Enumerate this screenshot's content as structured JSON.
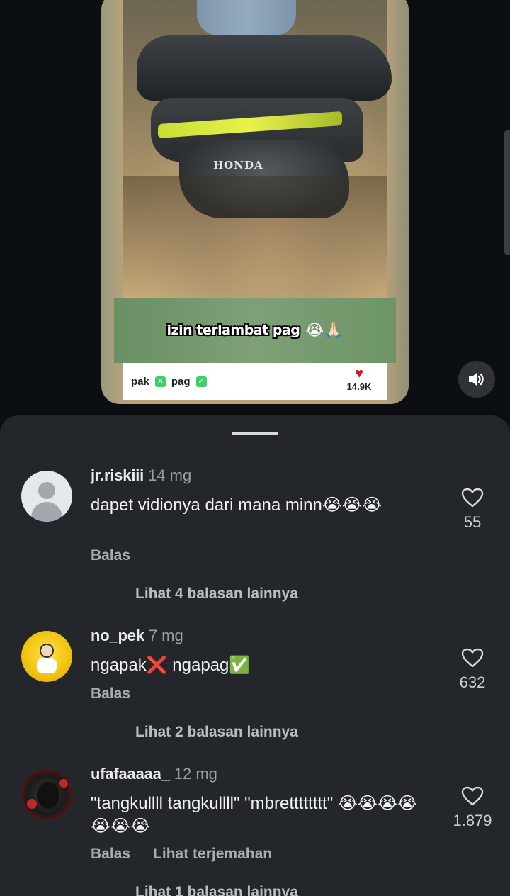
{
  "video": {
    "brand_mark": "HONDA",
    "caption": "izin terlambat pag",
    "caption_emoji": "😭🙏🏻",
    "strip_text_1": "pak",
    "strip_text_2": "pag",
    "like_count": "14.9K"
  },
  "comments": [
    {
      "username": "jr.riskiii",
      "time": "14 mg",
      "text": "dapet vidionya dari mana minn😭😭😭",
      "reply_label": "Balas",
      "likes": "55",
      "more_replies": "Lihat 4 balasan lainnya"
    },
    {
      "username": "no_pek",
      "time": "7 mg",
      "text": "ngapak❌ ngapag✅",
      "reply_label": "Balas",
      "likes": "632",
      "more_replies": "Lihat 2 balasan lainnya"
    },
    {
      "username": "ufafaaaaa_",
      "time": "12 mg",
      "text": "\"tangkullll tangkullll\" \"mbretttttttt\" 😭😭😭😭😭😭😭",
      "reply_label": "Balas",
      "translate_label": "Lihat terjemahan",
      "likes": "1.879",
      "more_replies": "Lihat 1 balasan lainnya"
    }
  ]
}
